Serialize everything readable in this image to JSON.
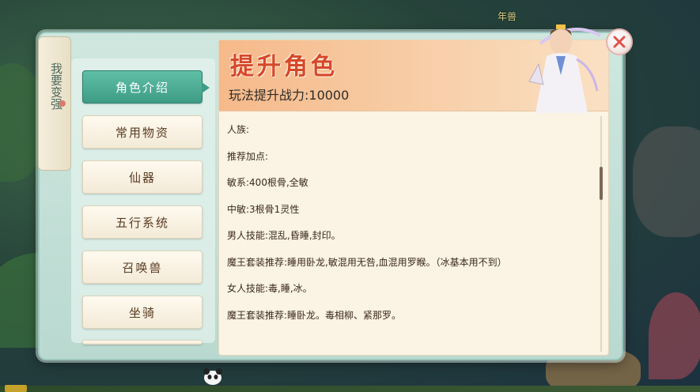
{
  "top_right_label": "年兽",
  "sidebar_title": "我要变强",
  "nav": {
    "items": [
      {
        "label": "角色介绍",
        "active": true
      },
      {
        "label": "常用物资",
        "active": false
      },
      {
        "label": "仙器",
        "active": false
      },
      {
        "label": "五行系统",
        "active": false
      },
      {
        "label": "召唤兽",
        "active": false
      },
      {
        "label": "坐骑",
        "active": false
      }
    ]
  },
  "banner": {
    "title": "提升角色",
    "subtitle": "玩法提升战力:10000"
  },
  "content": {
    "lines": [
      "人族:",
      "推荐加点:",
      "敏系:400根骨,全敏",
      "中敏:3根骨1灵性",
      "男人技能:混乱,昏睡,封印。",
      "魔王套装推荐:睡用卧龙,敏混用无咎,血混用罗睺。（冰基本用不到）",
      "女人技能:毒,睡,冰。",
      "魔王套装推荐:睡卧龙。毒相柳、紧那罗。"
    ]
  },
  "colors": {
    "active_tab": "#3e9c86",
    "title_red": "#d6482a",
    "close_red": "#e0524a"
  },
  "icons": {
    "close": "close-icon",
    "character": "character-portrait-icon"
  }
}
